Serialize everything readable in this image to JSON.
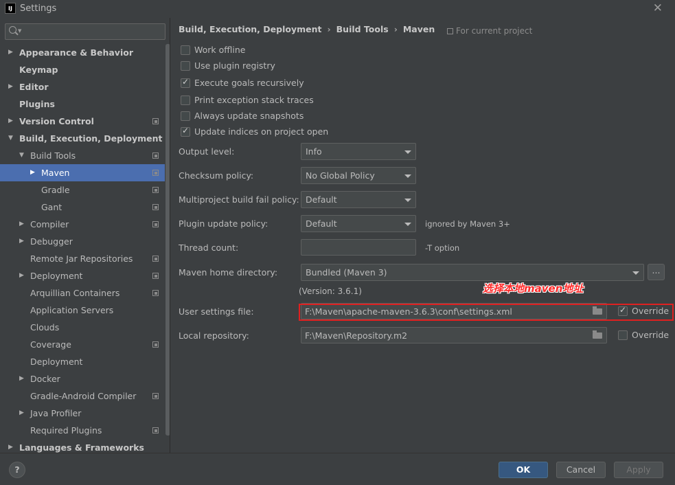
{
  "window": {
    "title": "Settings",
    "logo": "IJ"
  },
  "sidebar": {
    "search_placeholder": "",
    "items": [
      {
        "label": "Appearance & Behavior",
        "arrow": "▶"
      },
      {
        "label": "Keymap",
        "arrow": ""
      },
      {
        "label": "Editor",
        "arrow": "▶"
      },
      {
        "label": "Plugins",
        "arrow": ""
      },
      {
        "label": "Version Control",
        "arrow": "▶"
      },
      {
        "label": "Build, Execution, Deployment",
        "arrow": "▼"
      },
      {
        "label": "Build Tools",
        "arrow": "▼"
      },
      {
        "label": "Maven",
        "arrow": "▶"
      },
      {
        "label": "Gradle",
        "arrow": ""
      },
      {
        "label": "Gant",
        "arrow": ""
      },
      {
        "label": "Compiler",
        "arrow": "▶"
      },
      {
        "label": "Debugger",
        "arrow": "▶"
      },
      {
        "label": "Remote Jar Repositories",
        "arrow": ""
      },
      {
        "label": "Deployment",
        "arrow": "▶"
      },
      {
        "label": "Arquillian Containers",
        "arrow": ""
      },
      {
        "label": "Application Servers",
        "arrow": ""
      },
      {
        "label": "Clouds",
        "arrow": ""
      },
      {
        "label": "Coverage",
        "arrow": ""
      },
      {
        "label": "Deployment",
        "arrow": ""
      },
      {
        "label": "Docker",
        "arrow": "▶"
      },
      {
        "label": "Gradle-Android Compiler",
        "arrow": ""
      },
      {
        "label": "Java Profiler",
        "arrow": "▶"
      },
      {
        "label": "Required Plugins",
        "arrow": ""
      },
      {
        "label": "Languages & Frameworks",
        "arrow": "▶"
      }
    ]
  },
  "breadcrumb": [
    "Build, Execution, Deployment",
    "Build Tools",
    "Maven"
  ],
  "breadcrumb_sep": "›",
  "for_current_project": "For current project",
  "checkboxes": [
    {
      "label": "Work offline",
      "checked": false
    },
    {
      "label": "Use plugin registry",
      "checked": false
    },
    {
      "label": "Execute goals recursively",
      "checked": true
    },
    {
      "label": "Print exception stack traces",
      "checked": false
    },
    {
      "label": "Always update snapshots",
      "checked": false
    },
    {
      "label": "Update indices on project open",
      "checked": true
    }
  ],
  "fields": {
    "output_level": {
      "label": "Output level:",
      "value": "Info"
    },
    "checksum_policy": {
      "label": "Checksum policy:",
      "value": "No Global Policy"
    },
    "multiproject_fail": {
      "label": "Multiproject build fail policy:",
      "value": "Default"
    },
    "plugin_update": {
      "label": "Plugin update policy:",
      "value": "Default",
      "hint": "ignored by Maven 3+"
    },
    "thread_count": {
      "label": "Thread count:",
      "value": "",
      "hint": "-T option"
    },
    "maven_home": {
      "label": "Maven home directory:",
      "value": "Bundled (Maven 3)",
      "browse": "...",
      "version": "(Version: 3.6.1)"
    },
    "user_settings": {
      "label": "User settings file:",
      "value": "F:\\Maven\\apache-maven-3.6.3\\conf\\settings.xml",
      "override_label": "Override",
      "override_checked": true
    },
    "local_repo": {
      "label": "Local repository:",
      "value": "F:\\Maven\\Repository.m2",
      "override_label": "Override",
      "override_checked": false
    }
  },
  "annotation": "选择本地maven地址",
  "buttons": {
    "help": "?",
    "ok": "OK",
    "cancel": "Cancel",
    "apply": "Apply"
  },
  "colors": {
    "selected": "#4b6eaf",
    "primary_button": "#365880",
    "highlight_box": "#e02020",
    "annotation": "#ff2a2a"
  }
}
